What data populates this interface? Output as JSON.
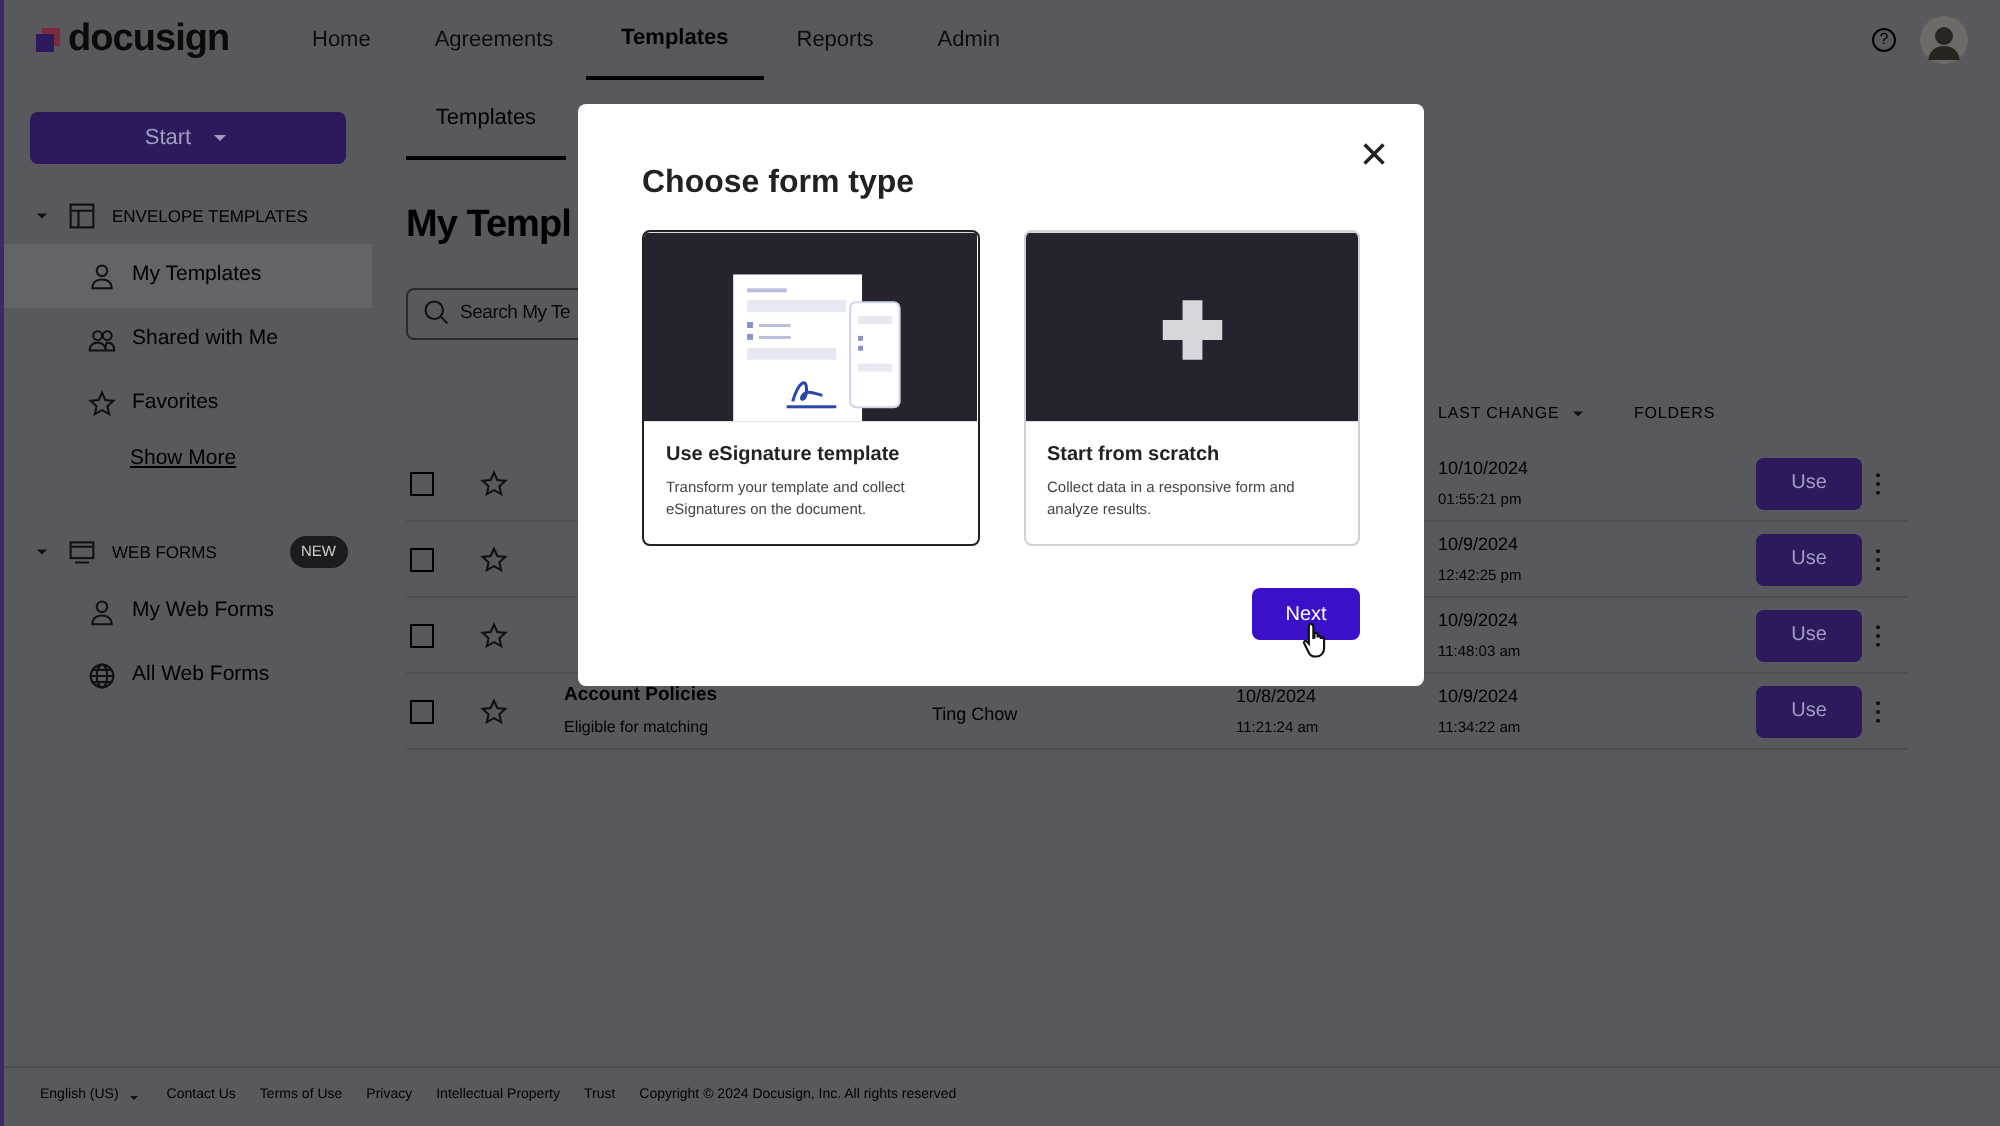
{
  "brand": {
    "name": "docusign"
  },
  "nav": {
    "items": [
      {
        "label": "Home",
        "selected": false
      },
      {
        "label": "Agreements",
        "selected": false
      },
      {
        "label": "Templates",
        "selected": true
      },
      {
        "label": "Reports",
        "selected": false
      },
      {
        "label": "Admin",
        "selected": false
      }
    ],
    "help": "?"
  },
  "sidebar": {
    "start_button": "Start",
    "sections": [
      {
        "title": "ENVELOPE TEMPLATES",
        "kind": "envelope",
        "expanded": true,
        "items": [
          {
            "label": "My Templates",
            "selected": true
          },
          {
            "label": "Shared with Me",
            "selected": false
          },
          {
            "label": "Favorites",
            "selected": false
          }
        ],
        "more": "Show More"
      },
      {
        "title": "WEB FORMS",
        "kind": "webforms",
        "badge": "NEW",
        "expanded": true,
        "items": [
          {
            "label": "My Web Forms",
            "selected": false
          },
          {
            "label": "All Web Forms",
            "selected": false
          }
        ]
      }
    ]
  },
  "subtabs": [
    {
      "label": "Templates",
      "selected": true
    }
  ],
  "heading": "My Templ",
  "search": {
    "placeholder": "Search My Te"
  },
  "table": {
    "columns": [
      {
        "label": "LAST CHANGE",
        "sorted": true
      },
      {
        "label": "FOLDERS",
        "sorted": false
      }
    ],
    "rows": [
      {
        "checked": false,
        "favorite": false,
        "last_change_date": "10/10/2024",
        "last_change_time": "01:55:21 pm",
        "action": "Use"
      },
      {
        "checked": false,
        "favorite": false,
        "last_change_date": "10/9/2024",
        "last_change_time": "12:42:25 pm",
        "action": "Use"
      },
      {
        "checked": false,
        "favorite": false,
        "last_change_date": "10/9/2024",
        "last_change_time": "11:48:03 am",
        "action": "Use"
      },
      {
        "checked": false,
        "favorite": false,
        "name": "Account Policies",
        "subtitle": "Eligible for matching",
        "owner": "Ting Chow",
        "created_date": "10/8/2024",
        "created_time": "11:21:24 am",
        "last_change_date": "10/9/2024",
        "last_change_time": "11:34:22 am",
        "action": "Use"
      }
    ]
  },
  "footer": {
    "language": "English (US)",
    "links": [
      "Contact Us",
      "Terms of Use",
      "Privacy",
      "Intellectual Property",
      "Trust"
    ],
    "copyright": "Copyright © 2024 Docusign, Inc. All rights reserved"
  },
  "modal": {
    "title": "Choose form type",
    "close": "×",
    "options": [
      {
        "kind": "esignature",
        "title": "Use eSignature template",
        "description": "Transform your template and collect eSignatures on the document.",
        "selected": true
      },
      {
        "kind": "scratch",
        "title": "Start from scratch",
        "description": "Collect data in a responsive form and analyze results.",
        "selected": false
      }
    ],
    "next_button": "Next"
  }
}
